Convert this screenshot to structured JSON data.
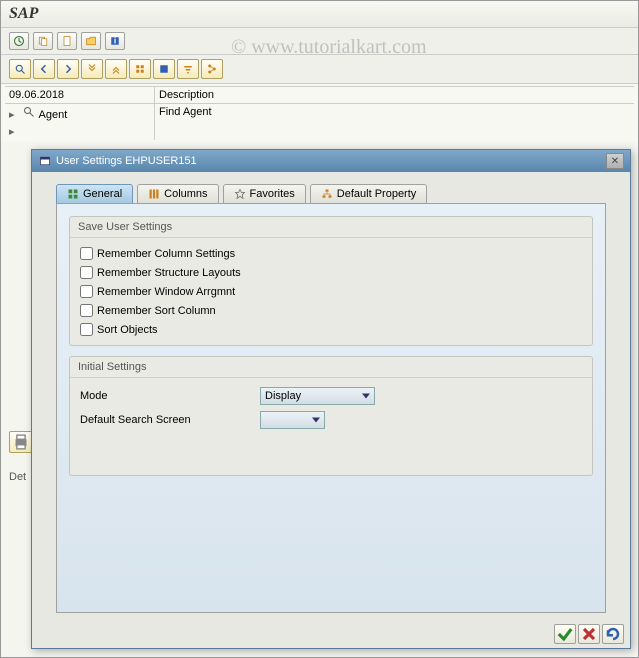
{
  "app_title": "SAP",
  "watermark": "© www.tutorialkart.com",
  "tree": {
    "col1_header": "09.06.2018",
    "col2_header": "Description",
    "row1_label": "Agent",
    "row1_desc": "Find Agent"
  },
  "dialog": {
    "title": "User Settings EHPUSER151",
    "tabs": {
      "general": "General",
      "columns": "Columns",
      "favorites": "Favorites",
      "default_property": "Default Property"
    },
    "group1": {
      "title": "Save User Settings",
      "chk1": "Remember Column Settings",
      "chk2": "Remember Structure Layouts",
      "chk3": "Remember Window Arrgmnt",
      "chk4": "Remember Sort Column",
      "chk5": "Sort Objects"
    },
    "group2": {
      "title": "Initial Settings",
      "mode_label": "Mode",
      "mode_value": "Display",
      "search_label": "Default Search Screen",
      "search_value": ""
    }
  },
  "sidebar": {
    "det": "Det"
  }
}
